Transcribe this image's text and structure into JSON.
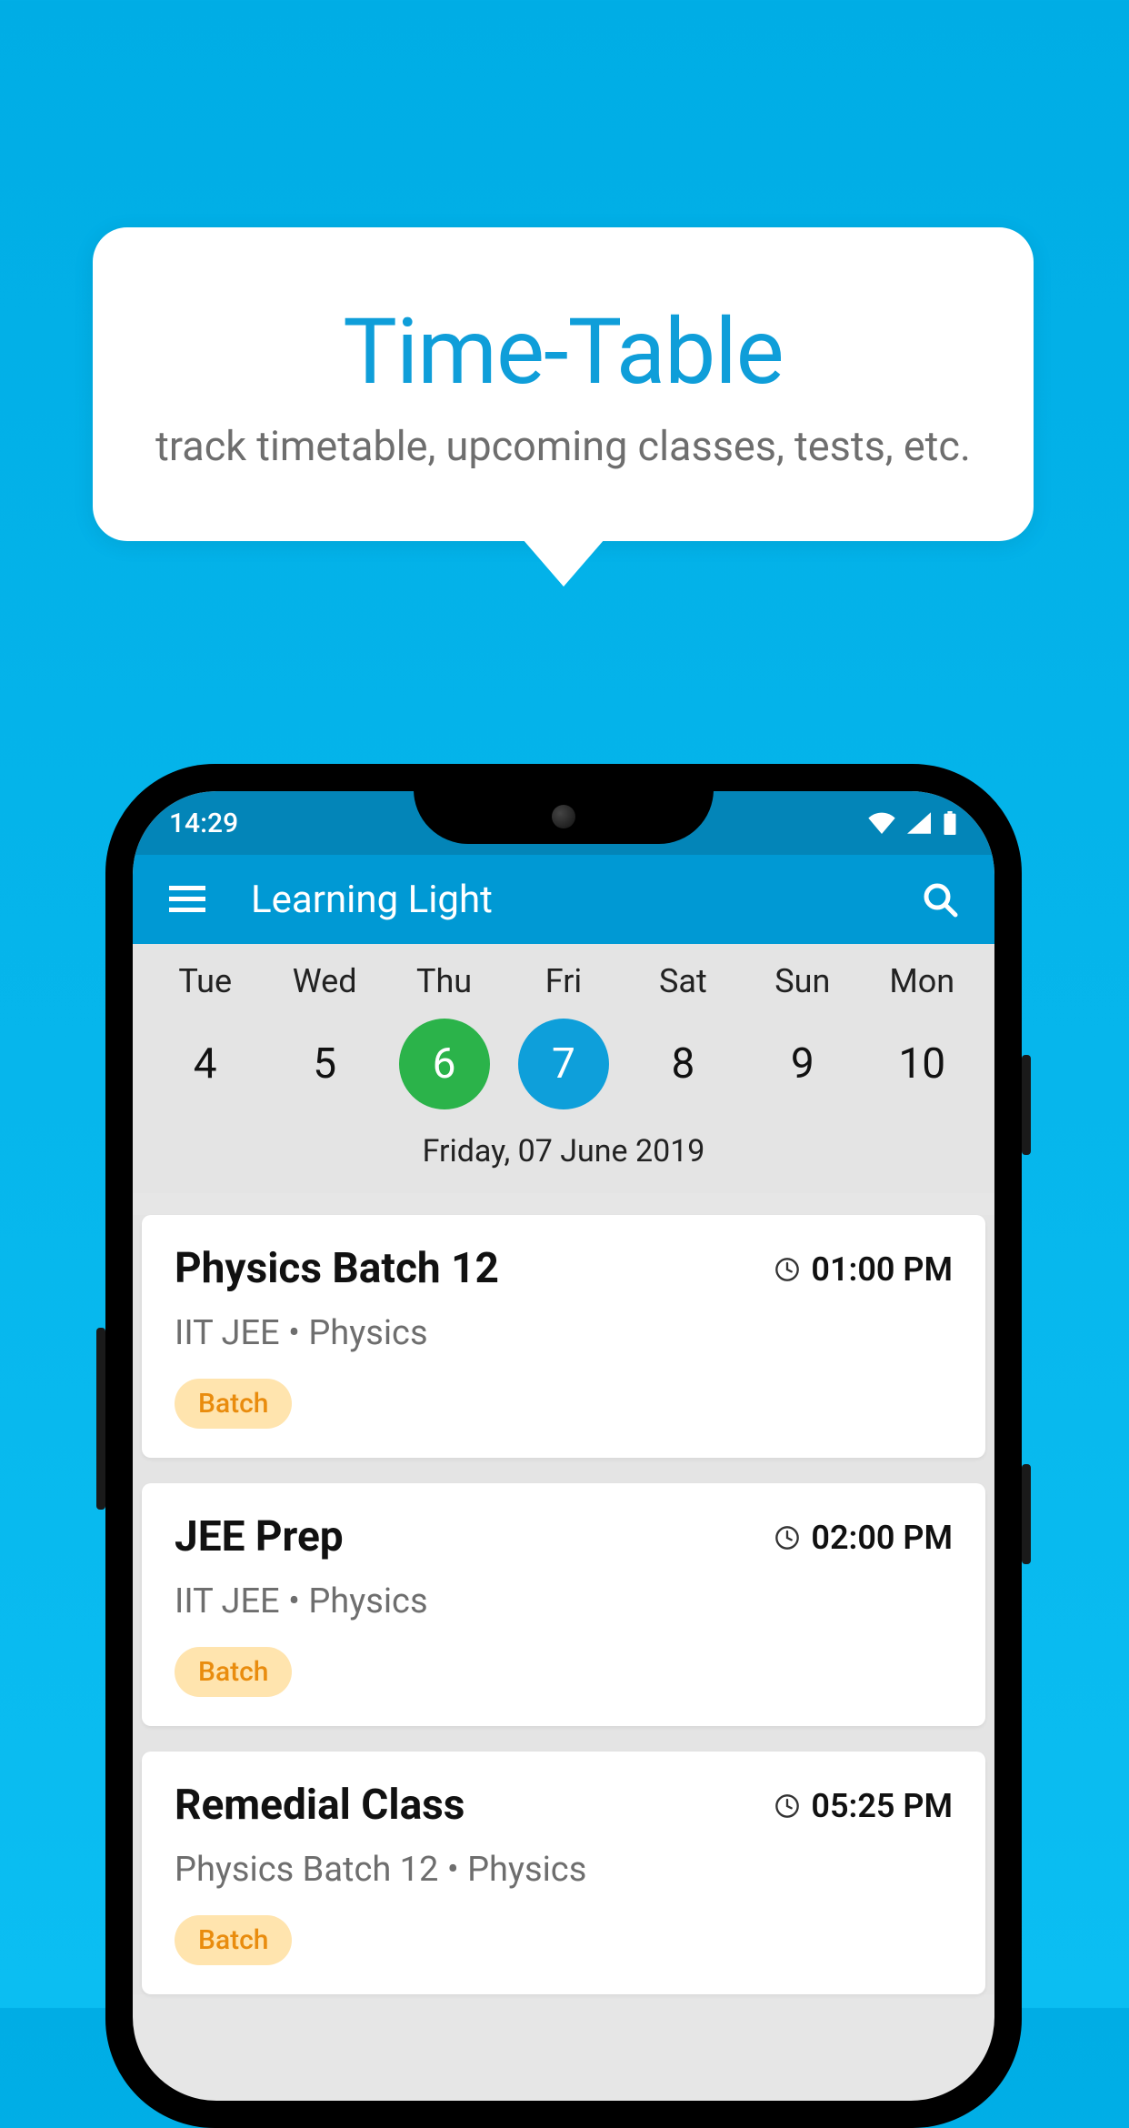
{
  "promo": {
    "title": "Time-Table",
    "subtitle": "track timetable, upcoming classes, tests, etc."
  },
  "statusbar": {
    "time": "14:29"
  },
  "appbar": {
    "title": "Learning Light"
  },
  "week": {
    "days": [
      {
        "name": "Tue",
        "num": "4",
        "state": ""
      },
      {
        "name": "Wed",
        "num": "5",
        "state": ""
      },
      {
        "name": "Thu",
        "num": "6",
        "state": "today"
      },
      {
        "name": "Fri",
        "num": "7",
        "state": "selected"
      },
      {
        "name": "Sat",
        "num": "8",
        "state": ""
      },
      {
        "name": "Sun",
        "num": "9",
        "state": ""
      },
      {
        "name": "Mon",
        "num": "10",
        "state": ""
      }
    ],
    "selected_label": "Friday, 07 June 2019"
  },
  "classes": [
    {
      "title": "Physics Batch 12",
      "time": "01:00 PM",
      "meta": "IIT JEE • Physics",
      "badge": "Batch"
    },
    {
      "title": "JEE Prep",
      "time": "02:00 PM",
      "meta": "IIT JEE • Physics",
      "badge": "Batch"
    },
    {
      "title": "Remedial Class",
      "time": "05:25 PM",
      "meta": "Physics Batch 12 • Physics",
      "badge": "Batch"
    }
  ]
}
